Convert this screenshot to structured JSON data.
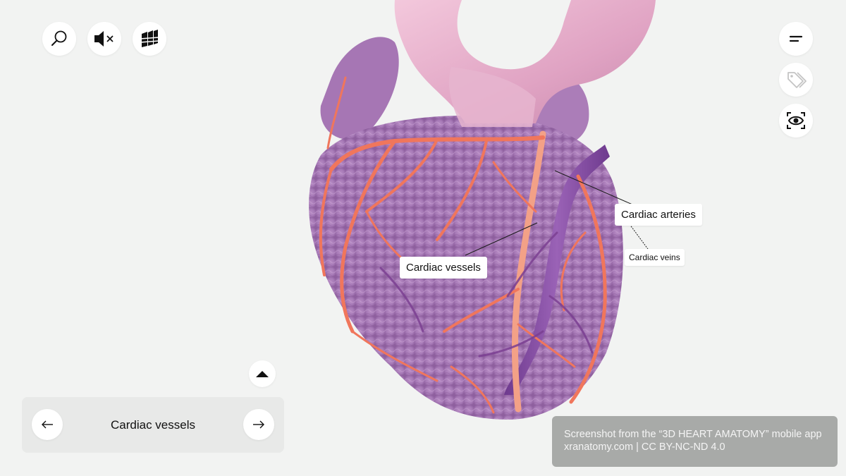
{
  "top_left_toolbar": {
    "search_icon": "search-icon",
    "mute_icon": "speaker-muted-icon",
    "layers_icon": "stacked-layers-icon"
  },
  "top_right_toolbar": {
    "menu_icon": "menu-lines-icon",
    "labels_icon": "tags-icon",
    "view_icon": "eye-focus-icon"
  },
  "labels": {
    "cardiac_arteries": "Cardiac arteries",
    "cardiac_veins": "Cardiac veins",
    "cardiac_vessels": "Cardiac vessels"
  },
  "bottom_nav": {
    "title": "Cardiac vessels",
    "prev_icon": "arrow-left-icon",
    "next_icon": "arrow-right-icon",
    "expand_icon": "triangle-up-icon"
  },
  "credit": {
    "line1": "Screenshot from the “3D HEART AMATOMY” mobile app",
    "line2": "xranatomy.com | CC BY-NC-ND 4.0"
  },
  "colors": {
    "background": "#f2f3f2",
    "heart_muscle": "#b47ab8",
    "arteries": "#f0765c",
    "veins": "#8a4ca0",
    "aorta": "#e9b3cf"
  }
}
